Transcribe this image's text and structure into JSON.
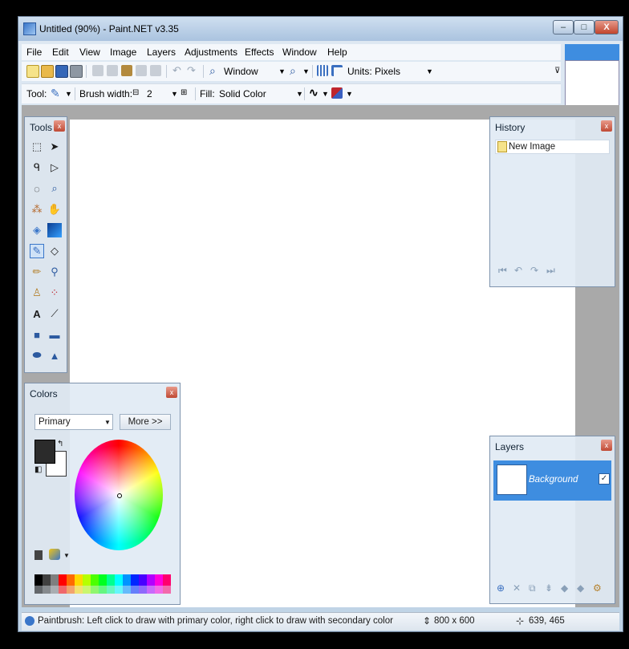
{
  "window": {
    "title": "Untitled (90%) - Paint.NET v3.35",
    "minimize_glyph": "–",
    "maximize_glyph": "□",
    "close_glyph": "X"
  },
  "menu": [
    "File",
    "Edit",
    "View",
    "Image",
    "Layers",
    "Adjustments",
    "Effects",
    "Window",
    "Help"
  ],
  "toolbar1": {
    "window_label": "Window",
    "units_label": "Units:",
    "units_value": "Pixels"
  },
  "toolbar2": {
    "tool_label": "Tool:",
    "brush_width_label": "Brush width:",
    "brush_width_value": "2",
    "fill_label": "Fill:",
    "fill_value": "Solid Color"
  },
  "tools_panel": {
    "title": "Tools"
  },
  "history_panel": {
    "title": "History",
    "items": [
      "New Image"
    ]
  },
  "colors_panel": {
    "title": "Colors",
    "mode_value": "Primary",
    "more_button": "More >>",
    "primary_color": "#2b2b2b",
    "secondary_color": "#ffffff"
  },
  "layers_panel": {
    "title": "Layers",
    "layers": [
      {
        "name": "Background",
        "visible": true
      }
    ]
  },
  "statusbar": {
    "hint": "Paintbrush: Left click to draw with primary color, right click to draw with secondary color",
    "image_size": "800 x 600",
    "cursor_pos": "639, 465"
  },
  "palette": [
    "#000000",
    "#404040",
    "#7f7f7f",
    "#ff0000",
    "#ff6a00",
    "#ffd800",
    "#b6ff00",
    "#4cff00",
    "#00ff21",
    "#00ff90",
    "#00ffff",
    "#0094ff",
    "#0026ff",
    "#4800ff",
    "#b200ff",
    "#ff00dc",
    "#ff006e"
  ]
}
